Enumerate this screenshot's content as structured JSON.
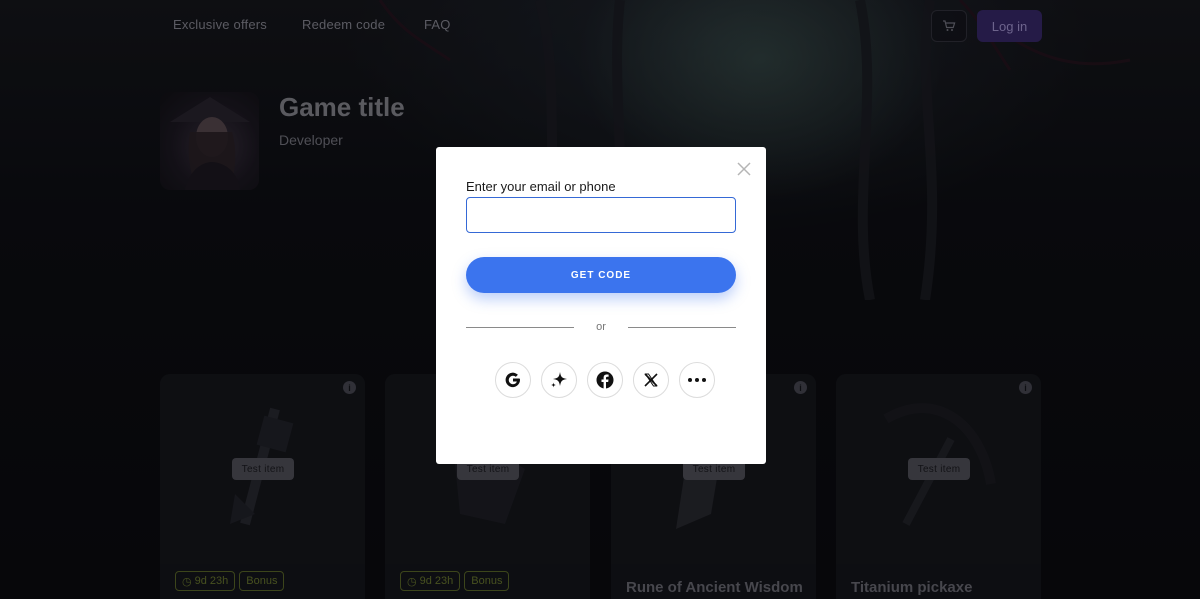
{
  "nav": {
    "links": [
      "Exclusive offers",
      "Redeem code",
      "FAQ"
    ],
    "cart_icon": "cart-icon",
    "login_label": "Log in"
  },
  "game": {
    "title": "Game title",
    "developer": "Developer"
  },
  "cards": [
    {
      "tag": "Test item",
      "timer": "9d 23h",
      "bonus": "Bonus",
      "title": ""
    },
    {
      "tag": "Test item",
      "timer": "9d 23h",
      "bonus": "Bonus",
      "title": ""
    },
    {
      "tag": "Test item",
      "timer": "",
      "bonus": "",
      "title": "Rune of Ancient Wisdom"
    },
    {
      "tag": "Test item",
      "timer": "",
      "bonus": "",
      "title": "Titanium pickaxe"
    }
  ],
  "modal": {
    "field_label": "Enter your email or phone",
    "field_value": "",
    "get_code_label": "GET CODE",
    "or_label": "or",
    "social_icons": [
      "google-icon",
      "sparkle-icon",
      "facebook-icon",
      "x-icon",
      "more-icon"
    ]
  },
  "colors": {
    "accent": "#3b74ee",
    "login_bg": "#3a2a6e",
    "badge": "#6e7d31"
  }
}
